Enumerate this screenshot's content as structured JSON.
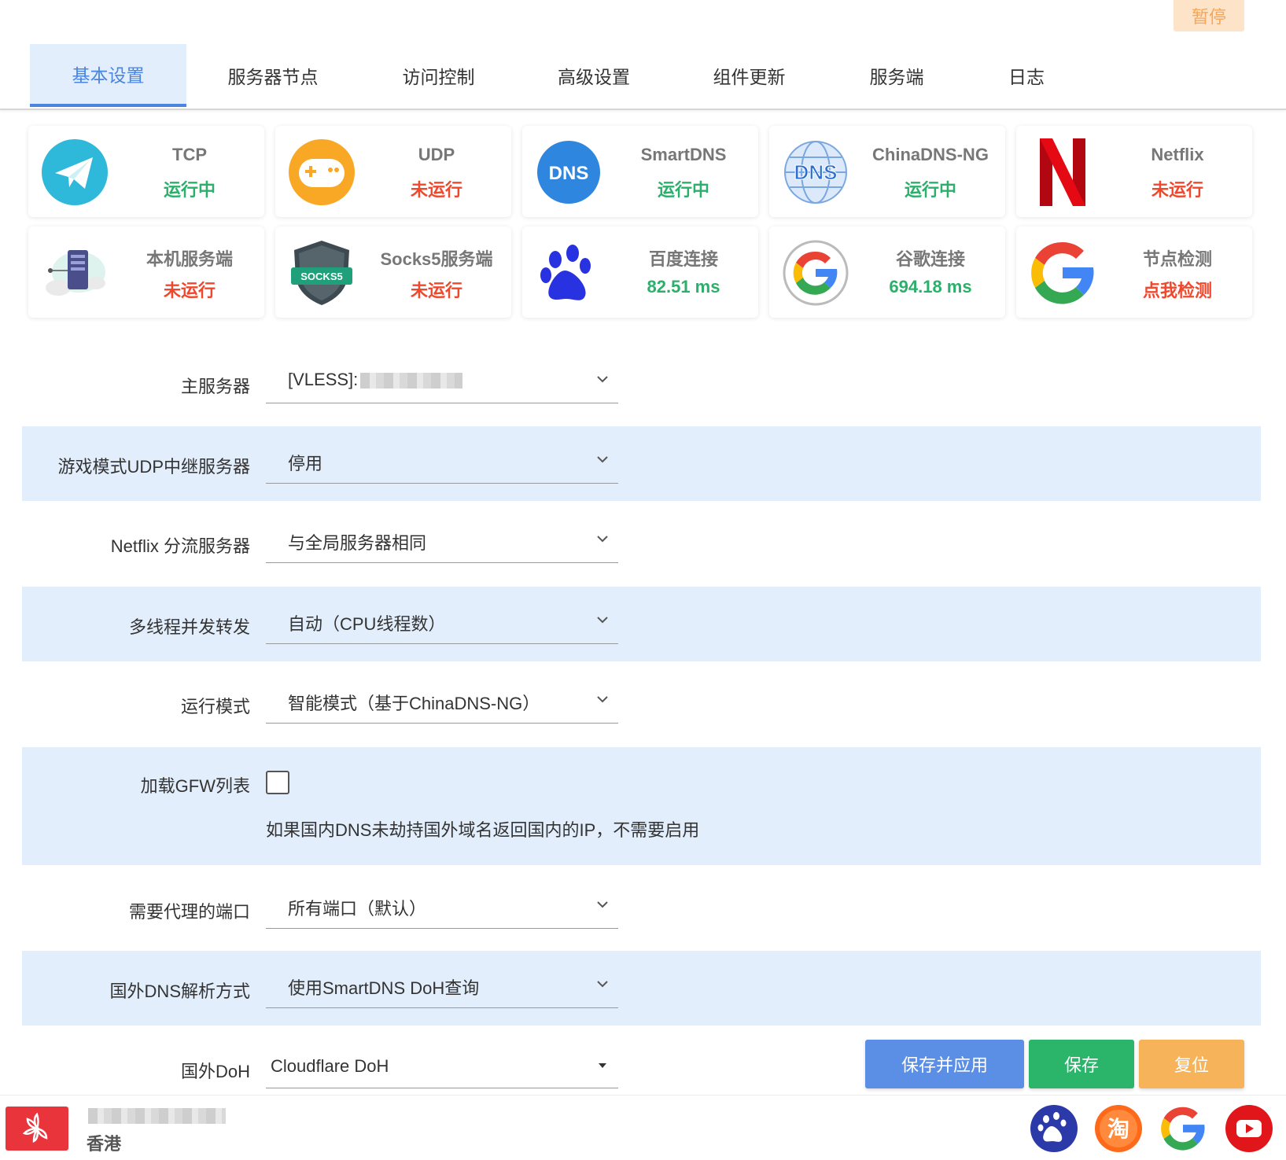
{
  "pause_label": "暂停",
  "tabs": [
    "基本设置",
    "服务器节点",
    "访问控制",
    "高级设置",
    "组件更新",
    "服务端",
    "日志"
  ],
  "cards": [
    {
      "title": "TCP",
      "status": "运行中",
      "status_color": "#2ab06a",
      "icon": "paper-plane-icon"
    },
    {
      "title": "UDP",
      "status": "未运行",
      "status_color": "#f0482d",
      "icon": "gamepad-icon"
    },
    {
      "title": "SmartDNS",
      "status": "运行中",
      "status_color": "#2ab06a",
      "icon": "dns-badge-icon"
    },
    {
      "title": "ChinaDNS-NG",
      "status": "运行中",
      "status_color": "#2ab06a",
      "icon": "dns-globe-icon"
    },
    {
      "title": "Netflix",
      "status": "未运行",
      "status_color": "#f0482d",
      "icon": "netflix-icon"
    },
    {
      "title": "本机服务端",
      "status": "未运行",
      "status_color": "#f0482d",
      "icon": "cloud-server-icon"
    },
    {
      "title": "Socks5服务端",
      "status": "未运行",
      "status_color": "#f0482d",
      "icon": "socks5-shield-icon"
    },
    {
      "title": "百度连接",
      "status": "82.51 ms",
      "status_color": "#2ab06a",
      "icon": "baidu-paw-icon"
    },
    {
      "title": "谷歌连接",
      "status": "694.18 ms",
      "status_color": "#2ab06a",
      "icon": "google-round-icon"
    },
    {
      "title": "节点检测",
      "status": "点我检测",
      "status_color": "#f0482d",
      "icon": "google-icon"
    }
  ],
  "icon_text": {
    "dns": "DNS",
    "socks5": "SOCKS5"
  },
  "form": {
    "main_server": {
      "label": "主服务器",
      "value": "[VLESS]:"
    },
    "game_udp": {
      "label": "游戏模式UDP中继服务器",
      "value": "停用"
    },
    "netflix_server": {
      "label": "Netflix 分流服务器",
      "value": "与全局服务器相同"
    },
    "threads": {
      "label": "多线程并发转发",
      "value": "自动（CPU线程数）"
    },
    "run_mode": {
      "label": "运行模式",
      "value": "智能模式（基于ChinaDNS-NG）"
    },
    "gfw_list": {
      "label": "加载GFW列表",
      "checked": false,
      "hint": "如果国内DNS未劫持国外域名返回国内的IP，不需要启用"
    },
    "proxy_ports": {
      "label": "需要代理的端口",
      "value": "所有端口（默认）"
    },
    "dns_mode": {
      "label": "国外DNS解析方式",
      "value": "使用SmartDNS DoH查询"
    },
    "foreign_doh": {
      "label": "国外DoH",
      "value": "Cloudflare DoH"
    }
  },
  "buttons": {
    "save_apply": "保存并应用",
    "save": "保存",
    "reset": "复位"
  },
  "footer": {
    "region": "香港",
    "links": [
      "baidu-link-icon",
      "taobao-link-icon",
      "google-link-icon",
      "youtube-link-icon"
    ],
    "taobao_char": "淘"
  },
  "colors": {
    "accent": "#4a86e0",
    "tab_active_bg": "#e3eefc",
    "green": "#2ab06a",
    "red": "#f0482d",
    "save_apply": "#5b8fe6",
    "save": "#2ab56a",
    "reset": "#f6b35a"
  }
}
